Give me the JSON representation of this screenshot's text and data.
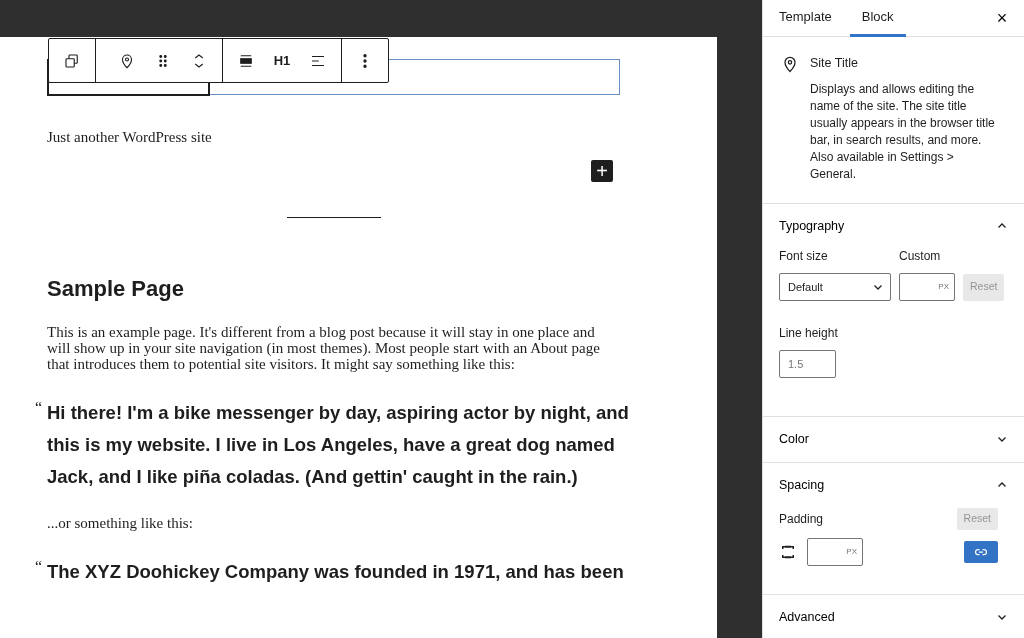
{
  "block_toolbar": {
    "groups": [
      [
        {
          "kind": "duplicate"
        }
      ],
      [
        {
          "kind": "pin"
        },
        {
          "kind": "drag"
        },
        {
          "kind": "move"
        }
      ],
      [
        {
          "kind": "justify"
        },
        {
          "kind": "text",
          "label": "H1"
        },
        {
          "kind": "align"
        }
      ],
      [
        {
          "kind": "more"
        }
      ]
    ]
  },
  "canvas": {
    "tagline": "Just another WordPress site",
    "add_button": "+",
    "heading": "Sample Page",
    "blocks": [
      {
        "kind": "paragraph",
        "text": "This is an example page. It's different from a blog post because it will stay in one place and will show up in your site navigation (in most themes). Most people start with an About page that introduces them to potential site visitors. It might say something like this:"
      },
      {
        "kind": "quote",
        "mark": "“",
        "text": "Hi there! I'm a bike messenger by day, aspiring actor by night, and this is my website. I live in Los Angeles, have a great dog named Jack, and I like piña coladas. (And gettin' caught in the rain.)"
      },
      {
        "kind": "paragraph",
        "text": "...or something like this:"
      },
      {
        "kind": "quote",
        "mark": "“",
        "text": "The XYZ Doohickey Company was founded in 1971, and has been"
      }
    ]
  },
  "sidebar": {
    "tabs": [
      {
        "label": "Template",
        "selected": false
      },
      {
        "label": "Block",
        "selected": true
      }
    ],
    "close": "×",
    "block_card": {
      "title": "Site Title",
      "description": "Displays and allows editing the name of the site. The site title usually appears in the browser title bar, in search results, and more. Also available in Settings > General."
    },
    "panels": [
      {
        "title": "Typography",
        "expanded": true,
        "kind": "typography",
        "font_size_label": "Font size",
        "font_size_value": "Default",
        "custom_label": "Custom",
        "unit": "PX",
        "reset": "Reset",
        "reset_disabled": true,
        "line_height_label": "Line height",
        "line_height_placeholder": "1.5"
      },
      {
        "title": "Color",
        "expanded": false
      },
      {
        "title": "Spacing",
        "expanded": true,
        "kind": "spacing",
        "padding_label": "Padding",
        "reset": "Reset",
        "reset_disabled": true,
        "unit": "PX",
        "linked": true
      },
      {
        "title": "Advanced",
        "expanded": false
      }
    ]
  }
}
